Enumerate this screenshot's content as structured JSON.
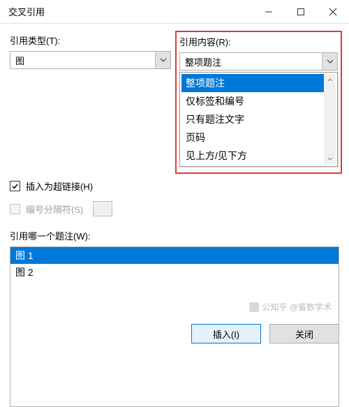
{
  "window": {
    "title": "交叉引用",
    "minimize_icon": "minimize-icon",
    "maximize_icon": "maximize-icon",
    "close_icon": "close-icon"
  },
  "left": {
    "ref_type_label": "引用类型(T):",
    "ref_type_value": "图",
    "insert_as_hyperlink_label": "插入为超链接(H)",
    "insert_as_hyperlink_checked": true,
    "number_separator_label": "编号分隔符(S)",
    "number_separator_checked": false,
    "which_label": "引用哪一个题注(W):",
    "items": [
      {
        "label": "图 1",
        "selected": true
      },
      {
        "label": "图 2",
        "selected": false
      }
    ]
  },
  "right": {
    "ref_content_label": "引用内容(R):",
    "ref_content_value": "整项题注",
    "dropdown_open": true,
    "dropdown_items": [
      {
        "label": "整项题注",
        "selected": true
      },
      {
        "label": "仅标签和编号",
        "selected": false
      },
      {
        "label": "只有题注文字",
        "selected": false
      },
      {
        "label": "页码",
        "selected": false
      },
      {
        "label": "见上方/见下方",
        "selected": false
      }
    ]
  },
  "buttons": {
    "insert": "插入(I)",
    "close": "关闭"
  },
  "watermark": "公知乎 @蜜数学术"
}
